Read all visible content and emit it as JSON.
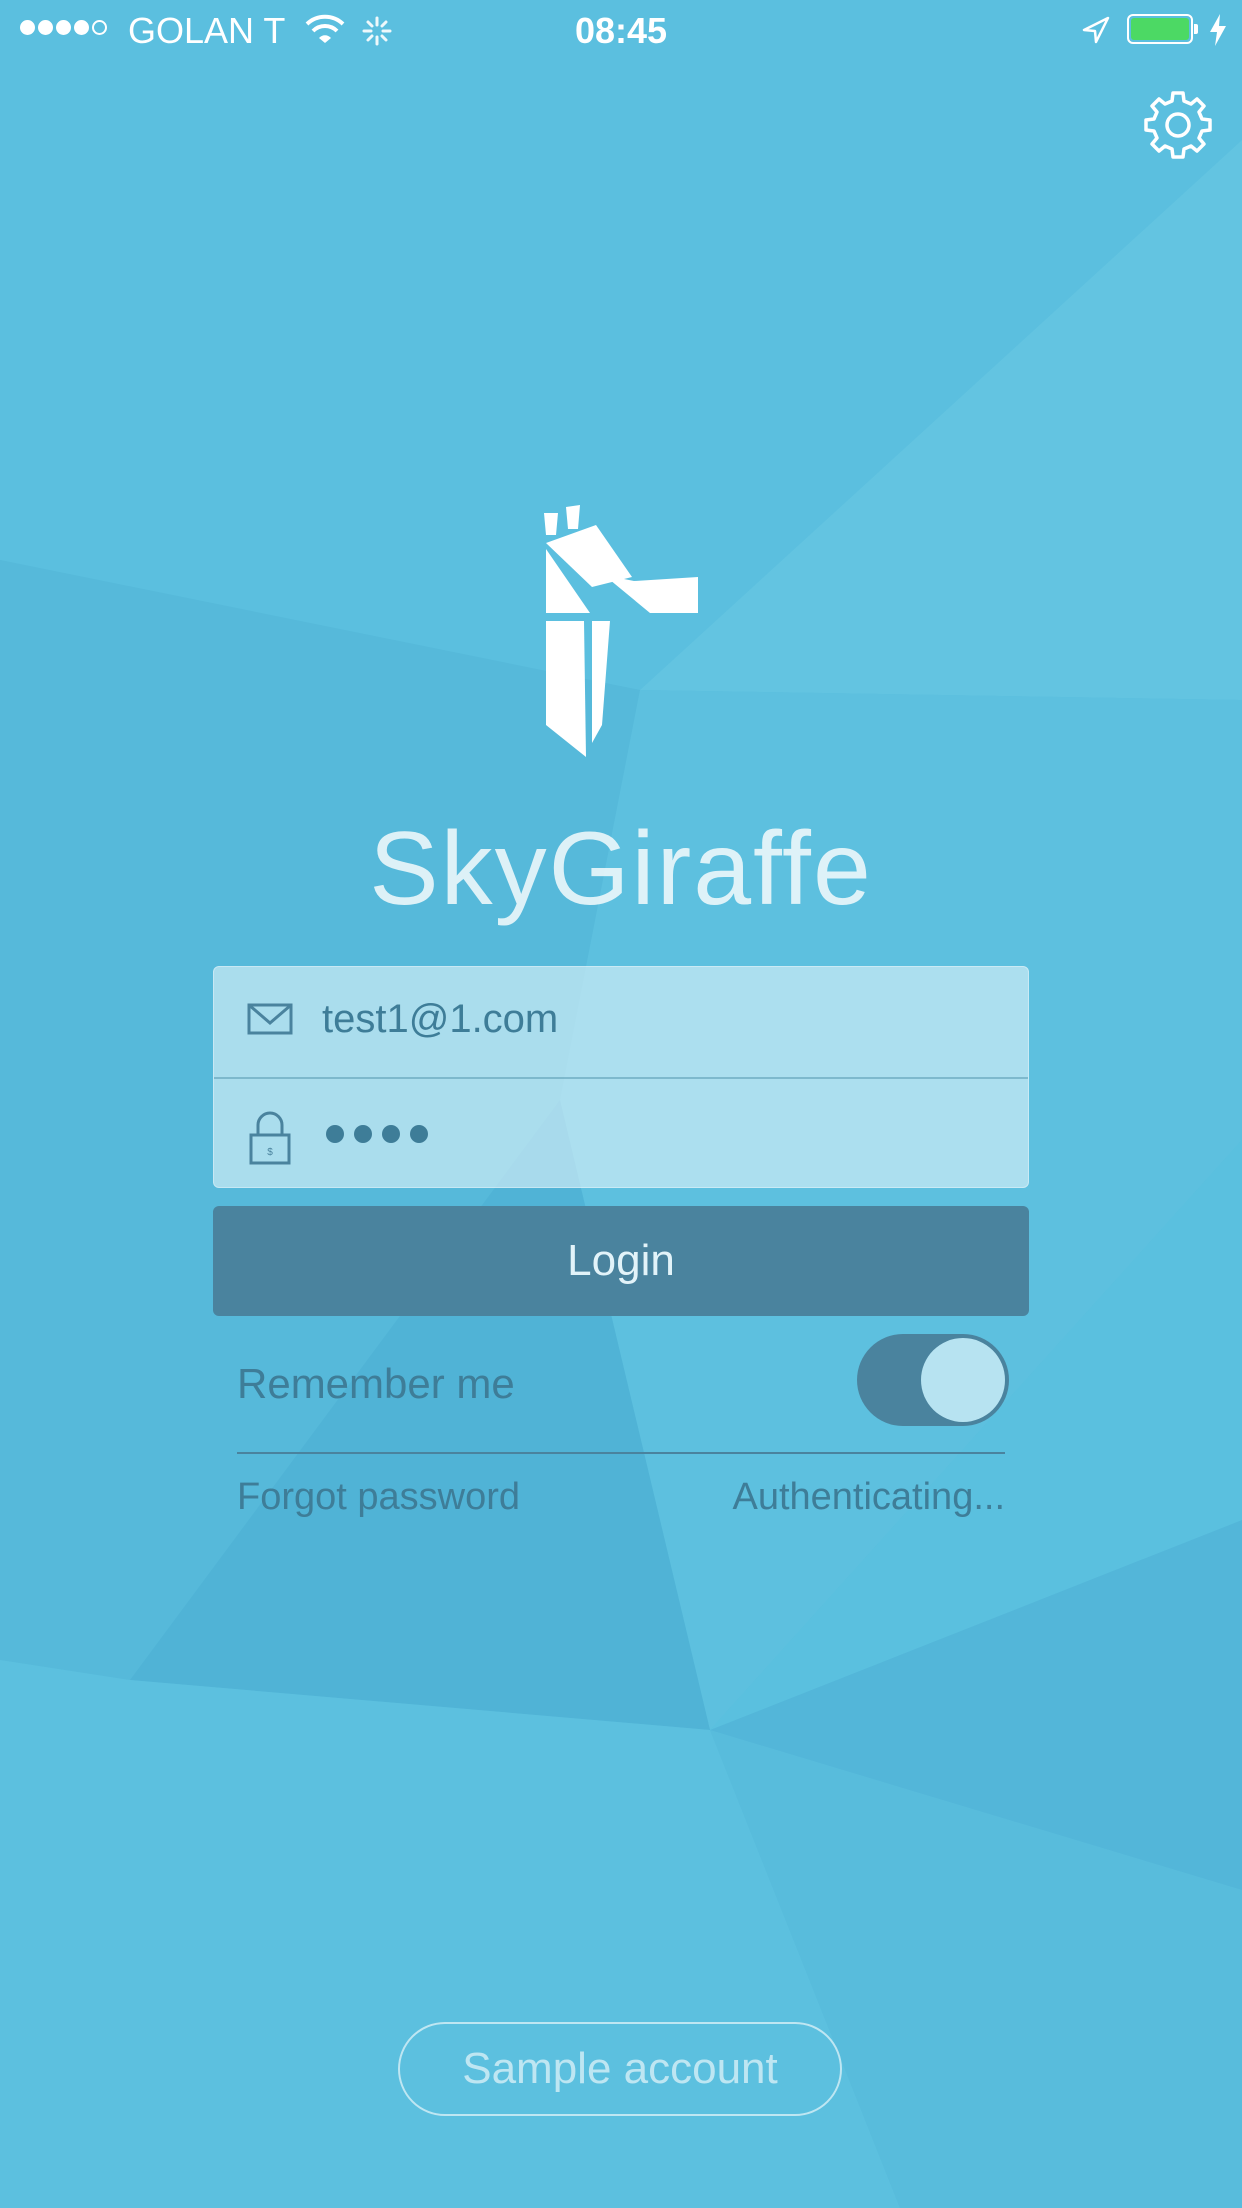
{
  "status_bar": {
    "carrier": "GOLAN T",
    "time": "08:45",
    "signal_strength": 4,
    "battery_color": "#4cd964"
  },
  "header": {
    "settings_icon": "gear-icon"
  },
  "brand": {
    "name": "SkyGiraffe"
  },
  "login_form": {
    "email_icon": "envelope-icon",
    "email_value": "test1@1.com",
    "password_icon": "lock-icon",
    "password_length": 4,
    "login_label": "Login",
    "remember_label": "Remember me",
    "remember_on": true,
    "forgot_label": "Forgot password",
    "status_text": "Authenticating..."
  },
  "footer": {
    "sample_account_label": "Sample account"
  },
  "colors": {
    "background": "#58bcdc",
    "button": "#4a839e",
    "text_dark": "#3e7d98"
  }
}
